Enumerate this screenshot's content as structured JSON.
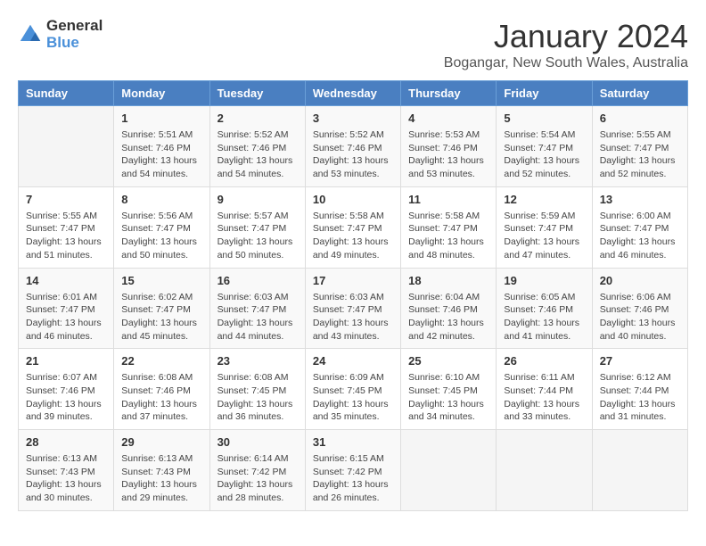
{
  "header": {
    "logo": {
      "general": "General",
      "blue": "Blue"
    },
    "title": "January 2024",
    "location": "Bogangar, New South Wales, Australia"
  },
  "calendar": {
    "days_of_week": [
      "Sunday",
      "Monday",
      "Tuesday",
      "Wednesday",
      "Thursday",
      "Friday",
      "Saturday"
    ],
    "weeks": [
      [
        {
          "day": "",
          "info": ""
        },
        {
          "day": "1",
          "info": "Sunrise: 5:51 AM\nSunset: 7:46 PM\nDaylight: 13 hours\nand 54 minutes."
        },
        {
          "day": "2",
          "info": "Sunrise: 5:52 AM\nSunset: 7:46 PM\nDaylight: 13 hours\nand 54 minutes."
        },
        {
          "day": "3",
          "info": "Sunrise: 5:52 AM\nSunset: 7:46 PM\nDaylight: 13 hours\nand 53 minutes."
        },
        {
          "day": "4",
          "info": "Sunrise: 5:53 AM\nSunset: 7:46 PM\nDaylight: 13 hours\nand 53 minutes."
        },
        {
          "day": "5",
          "info": "Sunrise: 5:54 AM\nSunset: 7:47 PM\nDaylight: 13 hours\nand 52 minutes."
        },
        {
          "day": "6",
          "info": "Sunrise: 5:55 AM\nSunset: 7:47 PM\nDaylight: 13 hours\nand 52 minutes."
        }
      ],
      [
        {
          "day": "7",
          "info": "Sunrise: 5:55 AM\nSunset: 7:47 PM\nDaylight: 13 hours\nand 51 minutes."
        },
        {
          "day": "8",
          "info": "Sunrise: 5:56 AM\nSunset: 7:47 PM\nDaylight: 13 hours\nand 50 minutes."
        },
        {
          "day": "9",
          "info": "Sunrise: 5:57 AM\nSunset: 7:47 PM\nDaylight: 13 hours\nand 50 minutes."
        },
        {
          "day": "10",
          "info": "Sunrise: 5:58 AM\nSunset: 7:47 PM\nDaylight: 13 hours\nand 49 minutes."
        },
        {
          "day": "11",
          "info": "Sunrise: 5:58 AM\nSunset: 7:47 PM\nDaylight: 13 hours\nand 48 minutes."
        },
        {
          "day": "12",
          "info": "Sunrise: 5:59 AM\nSunset: 7:47 PM\nDaylight: 13 hours\nand 47 minutes."
        },
        {
          "day": "13",
          "info": "Sunrise: 6:00 AM\nSunset: 7:47 PM\nDaylight: 13 hours\nand 46 minutes."
        }
      ],
      [
        {
          "day": "14",
          "info": "Sunrise: 6:01 AM\nSunset: 7:47 PM\nDaylight: 13 hours\nand 46 minutes."
        },
        {
          "day": "15",
          "info": "Sunrise: 6:02 AM\nSunset: 7:47 PM\nDaylight: 13 hours\nand 45 minutes."
        },
        {
          "day": "16",
          "info": "Sunrise: 6:03 AM\nSunset: 7:47 PM\nDaylight: 13 hours\nand 44 minutes."
        },
        {
          "day": "17",
          "info": "Sunrise: 6:03 AM\nSunset: 7:47 PM\nDaylight: 13 hours\nand 43 minutes."
        },
        {
          "day": "18",
          "info": "Sunrise: 6:04 AM\nSunset: 7:46 PM\nDaylight: 13 hours\nand 42 minutes."
        },
        {
          "day": "19",
          "info": "Sunrise: 6:05 AM\nSunset: 7:46 PM\nDaylight: 13 hours\nand 41 minutes."
        },
        {
          "day": "20",
          "info": "Sunrise: 6:06 AM\nSunset: 7:46 PM\nDaylight: 13 hours\nand 40 minutes."
        }
      ],
      [
        {
          "day": "21",
          "info": "Sunrise: 6:07 AM\nSunset: 7:46 PM\nDaylight: 13 hours\nand 39 minutes."
        },
        {
          "day": "22",
          "info": "Sunrise: 6:08 AM\nSunset: 7:46 PM\nDaylight: 13 hours\nand 37 minutes."
        },
        {
          "day": "23",
          "info": "Sunrise: 6:08 AM\nSunset: 7:45 PM\nDaylight: 13 hours\nand 36 minutes."
        },
        {
          "day": "24",
          "info": "Sunrise: 6:09 AM\nSunset: 7:45 PM\nDaylight: 13 hours\nand 35 minutes."
        },
        {
          "day": "25",
          "info": "Sunrise: 6:10 AM\nSunset: 7:45 PM\nDaylight: 13 hours\nand 34 minutes."
        },
        {
          "day": "26",
          "info": "Sunrise: 6:11 AM\nSunset: 7:44 PM\nDaylight: 13 hours\nand 33 minutes."
        },
        {
          "day": "27",
          "info": "Sunrise: 6:12 AM\nSunset: 7:44 PM\nDaylight: 13 hours\nand 31 minutes."
        }
      ],
      [
        {
          "day": "28",
          "info": "Sunrise: 6:13 AM\nSunset: 7:43 PM\nDaylight: 13 hours\nand 30 minutes."
        },
        {
          "day": "29",
          "info": "Sunrise: 6:13 AM\nSunset: 7:43 PM\nDaylight: 13 hours\nand 29 minutes."
        },
        {
          "day": "30",
          "info": "Sunrise: 6:14 AM\nSunset: 7:42 PM\nDaylight: 13 hours\nand 28 minutes."
        },
        {
          "day": "31",
          "info": "Sunrise: 6:15 AM\nSunset: 7:42 PM\nDaylight: 13 hours\nand 26 minutes."
        },
        {
          "day": "",
          "info": ""
        },
        {
          "day": "",
          "info": ""
        },
        {
          "day": "",
          "info": ""
        }
      ]
    ]
  }
}
